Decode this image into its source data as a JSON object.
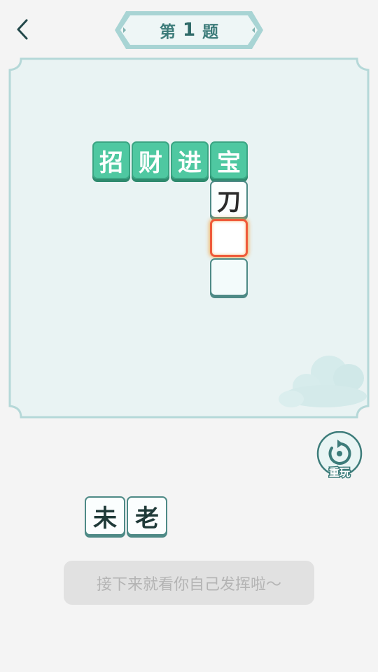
{
  "header": {
    "back_icon": "chevron-left-icon",
    "title_prefix": "第",
    "title_number": "1",
    "title_suffix": "题"
  },
  "board": {
    "horizontal_word": [
      "招",
      "财",
      "进",
      "宝"
    ],
    "vertical_tiles": [
      {
        "char": "刀",
        "state": "filled"
      },
      {
        "char": "",
        "state": "selected"
      },
      {
        "char": "",
        "state": "empty"
      }
    ]
  },
  "controls": {
    "replay_label": "重玩",
    "replay_icon": "replay-icon"
  },
  "options": [
    "未",
    "老"
  ],
  "hint": {
    "text": "接下来就看你自己发挥啦～"
  },
  "colors": {
    "accent": "#4fc8a1",
    "tile_border": "#4e8a86",
    "selected_border": "#ef5a3a",
    "banner": "#a8d4d4"
  }
}
